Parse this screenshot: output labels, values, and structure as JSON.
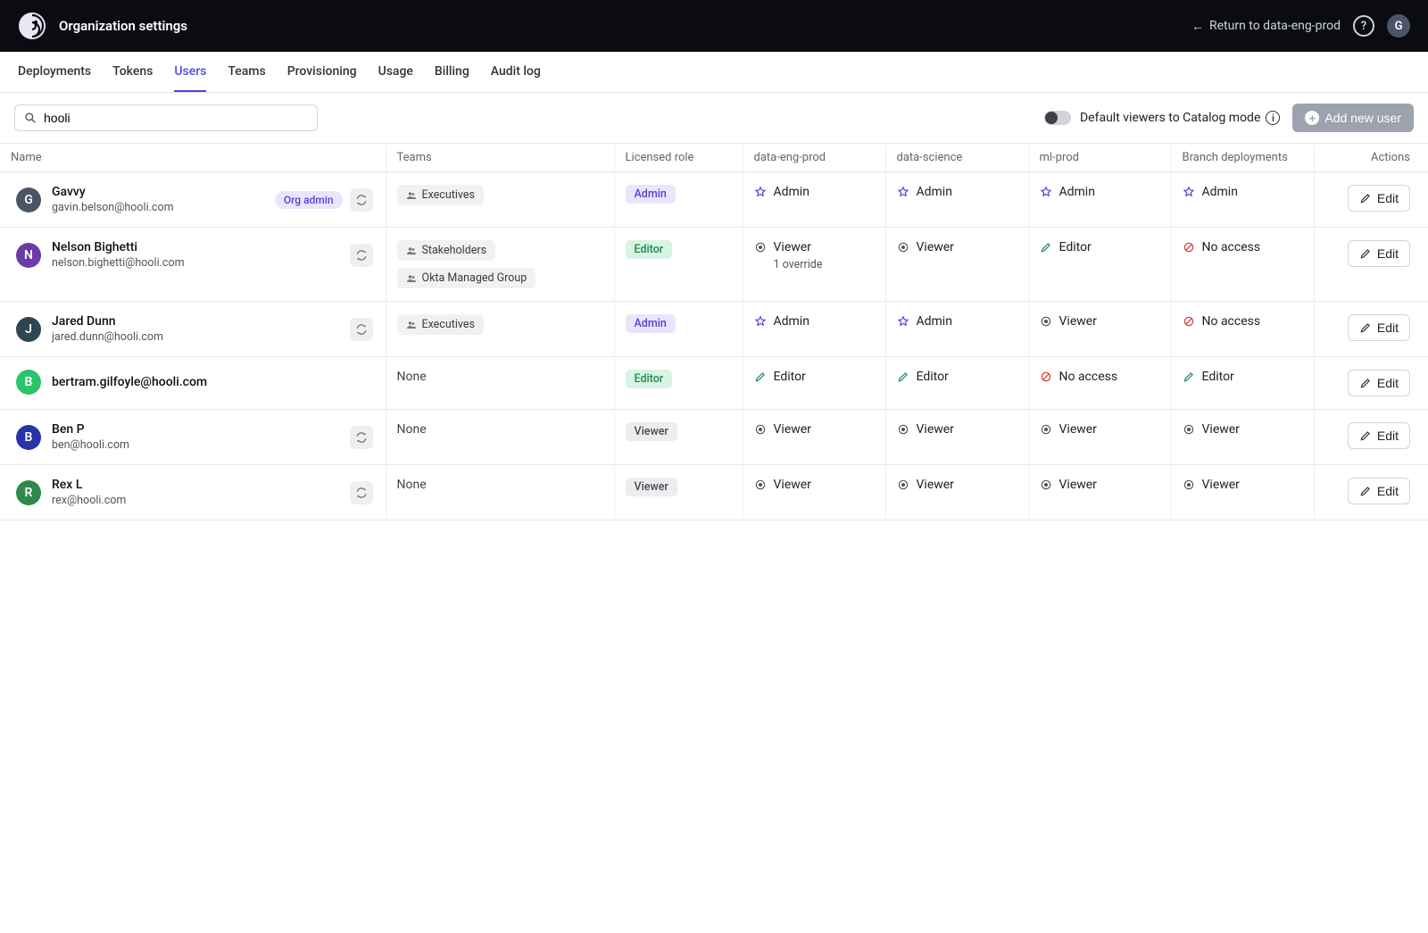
{
  "header": {
    "title": "Organization settings",
    "return_label": "Return to data-eng-prod",
    "avatar_letter": "G"
  },
  "tabs": [
    {
      "label": "Deployments",
      "active": false
    },
    {
      "label": "Tokens",
      "active": false
    },
    {
      "label": "Users",
      "active": true
    },
    {
      "label": "Teams",
      "active": false
    },
    {
      "label": "Provisioning",
      "active": false
    },
    {
      "label": "Usage",
      "active": false
    },
    {
      "label": "Billing",
      "active": false
    },
    {
      "label": "Audit log",
      "active": false
    }
  ],
  "toolbar": {
    "search_value": "hooli",
    "toggle_label": "Default viewers to Catalog mode",
    "add_label": "Add new user"
  },
  "columns": [
    "Name",
    "Teams",
    "Licensed role",
    "data-eng-prod",
    "data-science",
    "ml-prod",
    "Branch deployments",
    "Actions"
  ],
  "role_icons": {
    "Admin": "star",
    "Editor": "pencil",
    "Viewer": "dot",
    "No access": "ban"
  },
  "none_text": "None",
  "edit_label": "Edit",
  "users": [
    {
      "avatar": {
        "letter": "G",
        "bg": "#4a5568"
      },
      "name": "Gavvy",
      "email": "gavin.belson@hooli.com",
      "org_admin": true,
      "sync": true,
      "teams": [
        "Executives"
      ],
      "licensed_role": "Admin",
      "perms": [
        "Admin",
        "Admin",
        "Admin",
        "Admin"
      ],
      "overrides": [
        "",
        "",
        "",
        ""
      ]
    },
    {
      "avatar": {
        "letter": "N",
        "bg": "#6b3ba8"
      },
      "name": "Nelson Bighetti",
      "email": "nelson.bighetti@hooli.com",
      "org_admin": false,
      "sync": true,
      "teams": [
        "Stakeholders",
        "Okta Managed Group"
      ],
      "licensed_role": "Editor",
      "perms": [
        "Viewer",
        "Viewer",
        "Editor",
        "No access"
      ],
      "overrides": [
        "1 override",
        "",
        "",
        ""
      ]
    },
    {
      "avatar": {
        "letter": "J",
        "bg": "#2c4652"
      },
      "name": "Jared Dunn",
      "email": "jared.dunn@hooli.com",
      "org_admin": false,
      "sync": true,
      "teams": [
        "Executives"
      ],
      "licensed_role": "Admin",
      "perms": [
        "Admin",
        "Admin",
        "Viewer",
        "No access"
      ],
      "overrides": [
        "",
        "",
        "",
        ""
      ]
    },
    {
      "avatar": {
        "letter": "B",
        "bg": "#2cc36a"
      },
      "name": "",
      "email": "bertram.gilfoyle@hooli.com",
      "org_admin": false,
      "sync": false,
      "teams": [],
      "licensed_role": "Editor",
      "perms": [
        "Editor",
        "Editor",
        "No access",
        "Editor"
      ],
      "overrides": [
        "",
        "",
        "",
        ""
      ]
    },
    {
      "avatar": {
        "letter": "B",
        "bg": "#2734a8"
      },
      "name": "Ben P",
      "email": "ben@hooli.com",
      "org_admin": false,
      "sync": true,
      "teams": [],
      "licensed_role": "Viewer",
      "perms": [
        "Viewer",
        "Viewer",
        "Viewer",
        "Viewer"
      ],
      "overrides": [
        "",
        "",
        "",
        ""
      ]
    },
    {
      "avatar": {
        "letter": "R",
        "bg": "#2e8a4a"
      },
      "name": "Rex L",
      "email": "rex@hooli.com",
      "org_admin": false,
      "sync": true,
      "teams": [],
      "licensed_role": "Viewer",
      "perms": [
        "Viewer",
        "Viewer",
        "Viewer",
        "Viewer"
      ],
      "overrides": [
        "",
        "",
        "",
        ""
      ]
    }
  ]
}
